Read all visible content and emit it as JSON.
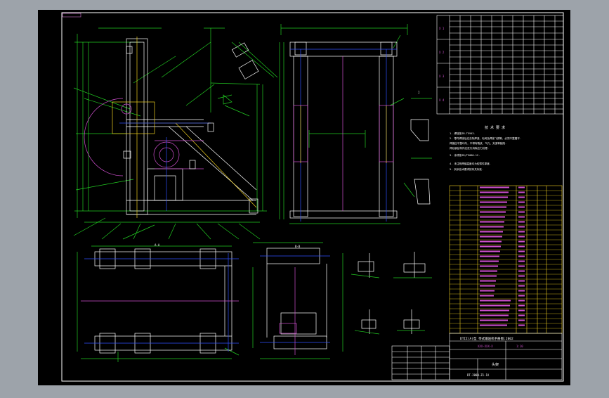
{
  "drawing": {
    "title_block": {
      "drawing_title": "DTII(A)型  带式输送机手册图:2002",
      "drawing_no": "XXX-XXX-X",
      "scale_label": "1:10",
      "part_name": "头架",
      "sheet_code": "DT-2000-Z1-1X"
    },
    "views": {
      "view_a": "A-A",
      "view_b": "B-B",
      "detail": "I"
    },
    "tech_requirements": {
      "heading": "技 术 要 求",
      "lines": [
        "1. 焊接按JB-T5943.",
        "2. 零件焊接后应去除焊渣、毛刺及焊接飞溅等，必须平整磨平.",
        "   焊缝应平整均匀，不得有裂纹、气孔、夹渣等缺陷.",
        "   焊后钢结构件应进行消除应力处理.",
        "3. 涂漆按JB/T5000.12.",
        "4. 未注明焊缝高度均为较薄件厚度.",
        "5. 其余技术要求按有关标准."
      ]
    }
  }
}
